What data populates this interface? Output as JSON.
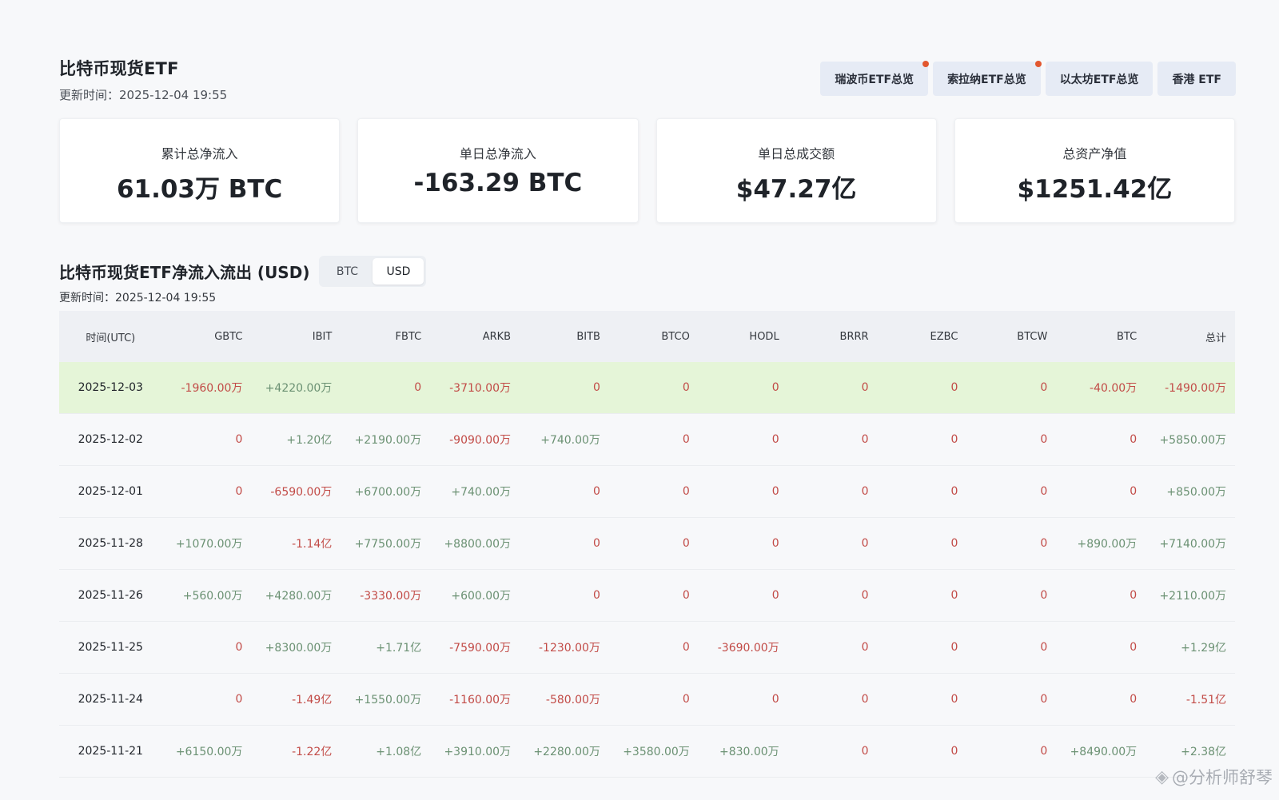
{
  "header": {
    "title": "比特币现货ETF",
    "update_time": "更新时间：2025-12-04 19:55"
  },
  "tabs": [
    {
      "label": "瑞波币ETF总览",
      "has_dot": true
    },
    {
      "label": "索拉纳ETF总览",
      "has_dot": true
    },
    {
      "label": "以太坊ETF总览",
      "has_dot": false
    },
    {
      "label": "香港 ETF",
      "has_dot": false
    }
  ],
  "stats": [
    {
      "label": "累计总净流入",
      "value": "61.03万 BTC"
    },
    {
      "label": "单日总净流入",
      "value": "-163.29 BTC"
    },
    {
      "label": "单日总成交额",
      "value": "$47.27亿"
    },
    {
      "label": "总资产净值",
      "value": "$1251.42亿"
    }
  ],
  "section": {
    "title": "比特币现货ETF净流入流出 (USD)",
    "toggle": [
      "BTC",
      "USD"
    ],
    "active_toggle": "USD",
    "update_time": "更新时间：2025-12-04 19:55"
  },
  "table": {
    "columns": [
      "时间(UTC)",
      "GBTC",
      "IBIT",
      "FBTC",
      "ARKB",
      "BITB",
      "BTCO",
      "HODL",
      "BRRR",
      "EZBC",
      "BTCW",
      "BTC",
      "总计"
    ],
    "rows": [
      {
        "cells": [
          "2025-12-03",
          "-1960.00万",
          "+4220.00万",
          "0",
          "-3710.00万",
          "0",
          "0",
          "0",
          "0",
          "0",
          "0",
          "-40.00万",
          "-1490.00万"
        ],
        "highlight": true
      },
      {
        "cells": [
          "2025-12-02",
          "0",
          "+1.20亿",
          "+2190.00万",
          "-9090.00万",
          "+740.00万",
          "0",
          "0",
          "0",
          "0",
          "0",
          "0",
          "+5850.00万"
        ]
      },
      {
        "cells": [
          "2025-12-01",
          "0",
          "-6590.00万",
          "+6700.00万",
          "+740.00万",
          "0",
          "0",
          "0",
          "0",
          "0",
          "0",
          "0",
          "+850.00万"
        ]
      },
      {
        "cells": [
          "2025-11-28",
          "+1070.00万",
          "-1.14亿",
          "+7750.00万",
          "+8800.00万",
          "0",
          "0",
          "0",
          "0",
          "0",
          "0",
          "+890.00万",
          "+7140.00万"
        ]
      },
      {
        "cells": [
          "2025-11-26",
          "+560.00万",
          "+4280.00万",
          "-3330.00万",
          "+600.00万",
          "0",
          "0",
          "0",
          "0",
          "0",
          "0",
          "0",
          "+2110.00万"
        ]
      },
      {
        "cells": [
          "2025-11-25",
          "0",
          "+8300.00万",
          "+1.71亿",
          "-7590.00万",
          "-1230.00万",
          "0",
          "-3690.00万",
          "0",
          "0",
          "0",
          "0",
          "+1.29亿"
        ]
      },
      {
        "cells": [
          "2025-11-24",
          "0",
          "-1.49亿",
          "+1550.00万",
          "-1160.00万",
          "-580.00万",
          "0",
          "0",
          "0",
          "0",
          "0",
          "0",
          "-1.51亿"
        ]
      },
      {
        "cells": [
          "2025-11-21",
          "+6150.00万",
          "-1.22亿",
          "+1.08亿",
          "+3910.00万",
          "+2280.00万",
          "+3580.00万",
          "+830.00万",
          "0",
          "0",
          "0",
          "+8490.00万",
          "+2.38亿"
        ]
      }
    ]
  },
  "watermark": {
    "text": "@分析师舒琴",
    "icon": "binance-diamond-icon"
  },
  "colors": {
    "positive": "#6b9173",
    "negative": "#c24b47",
    "highlight_row": "#e5f5d8",
    "tab_bg": "#e6ebf5",
    "dot": "#e2572f"
  }
}
